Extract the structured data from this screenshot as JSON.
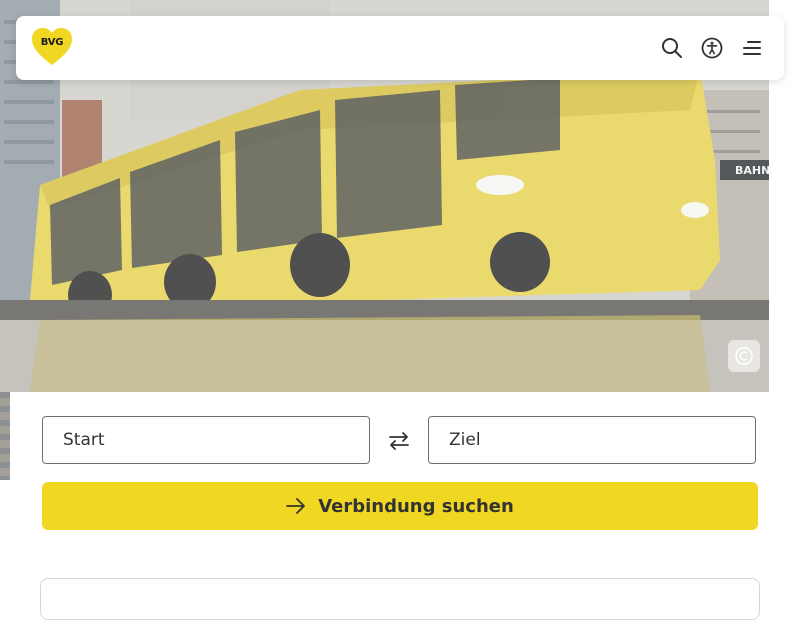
{
  "header": {
    "logo_text": "BVG",
    "icons": [
      "search-icon",
      "accessibility-icon",
      "menu-icon"
    ]
  },
  "hero": {
    "copyright_icon": "copyright-icon"
  },
  "journey_form": {
    "start_placeholder": "Start",
    "destination_placeholder": "Ziel",
    "swap_icon": "swap-arrows-icon",
    "submit_label": "Verbindung suchen",
    "submit_icon": "arrow-right-icon"
  },
  "colors": {
    "brand_yellow": "#f0d722",
    "text_dark": "#333333",
    "border": "#6f6f6f"
  }
}
